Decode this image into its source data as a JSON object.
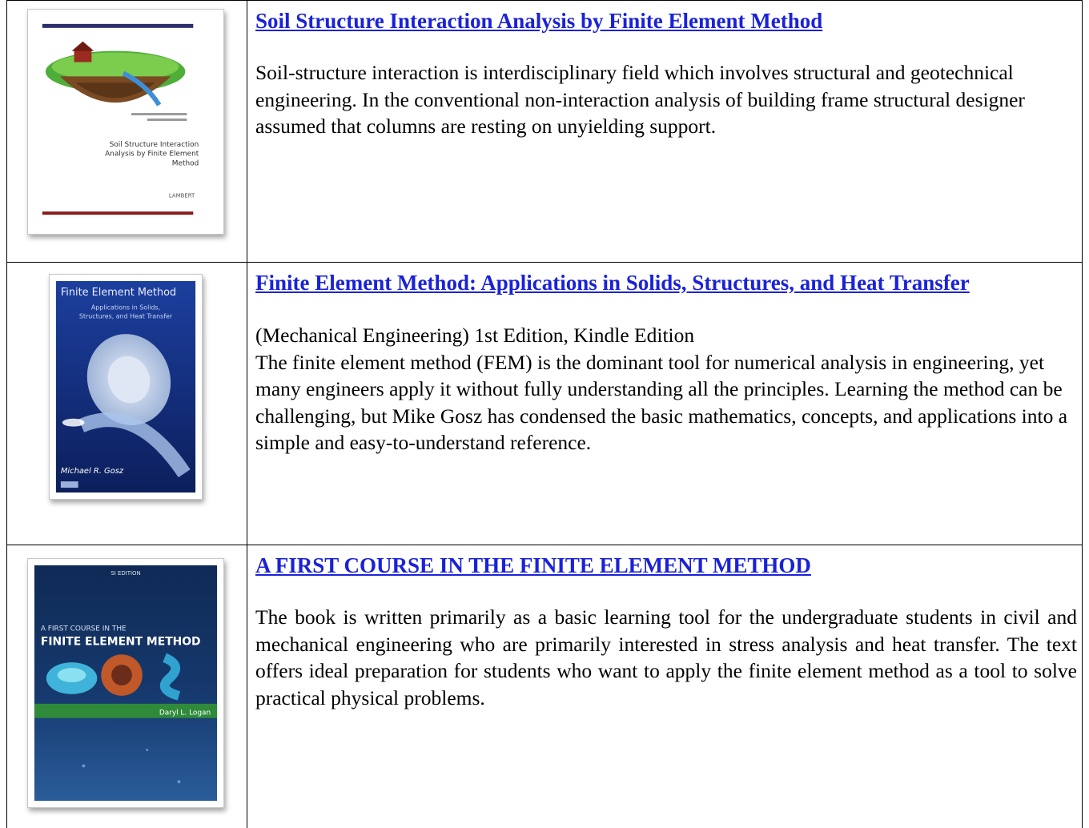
{
  "books": [
    {
      "title": "Soil Structure Interaction Analysis by Finite Element Method",
      "description": "Soil-structure interaction is interdisciplinary field which involves structural and geotechnical engineering. In the conventional non-interaction analysis of building frame structural designer assumed that columns are resting on unyielding support.",
      "cover": {
        "title_lines": [
          "Soil Structure Interaction",
          "Analysis by Finite Element",
          "Method"
        ],
        "publisher": "LAMBERT",
        "accent": "#2b2f6e",
        "stripe": "#8b1a1a"
      }
    },
    {
      "title": "Finite Element Method: Applications in Solids, Structures, and Heat Transfer",
      "description": "(Mechanical Engineering) 1st Edition, Kindle Edition\nThe finite element method (FEM) is the dominant tool for numerical analysis in engineering, yet many engineers apply it without fully understanding all the principles. Learning the method can be challenging, but Mike Gosz has condensed the basic mathematics, concepts, and applications into a simple and easy-to-understand reference.",
      "cover": {
        "title": "Finite Element Method",
        "subtitle_lines": [
          "Applications in Solids,",
          "Structures, and Heat Transfer"
        ],
        "author": "Michael R. Gosz",
        "accent": "#1c3f9e"
      }
    },
    {
      "title": "A FIRST COURSE IN THE FINITE ELEMENT METHOD",
      "description": "The book is written primarily as a basic learning tool for the undergraduate students in civil and mechanical engineering who are primarily interested in stress analysis and heat transfer. The text offers ideal preparation for students who want to apply the finite element method as a tool to solve practical physical problems.",
      "cover": {
        "edition": "SI EDITION",
        "title_small": "A FIRST COURSE IN THE",
        "title_big": "FINITE ELEMENT METHOD",
        "author": "Daryl L. Logan",
        "accent": "#12305f",
        "band": "#2f8a3a"
      }
    }
  ]
}
